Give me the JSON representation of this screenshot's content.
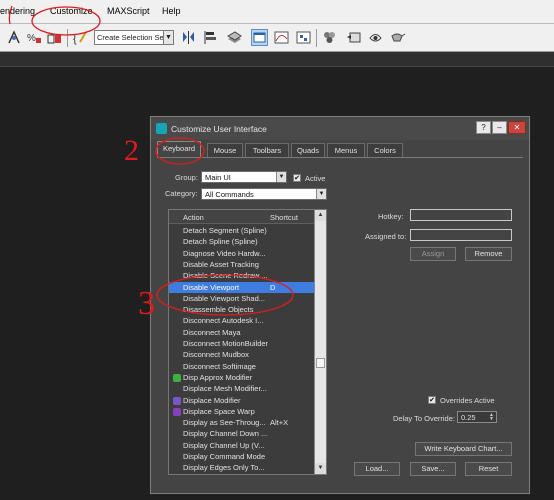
{
  "menubar": {
    "items": [
      {
        "label": "endering",
        "name": "menu-rendering"
      },
      {
        "label": "Customize",
        "name": "menu-customize"
      },
      {
        "label": "MAXScript",
        "name": "menu-maxscript"
      },
      {
        "label": "Help",
        "name": "menu-help"
      }
    ]
  },
  "toolbar": {
    "selection_set": "Create Selection Se",
    "icons": [
      "link-icon",
      "unlink-icon",
      "bind-space-warp-icon",
      "select-icon",
      "select-by-name-icon",
      "percent-snap-icon",
      "spinner-snap-icon",
      "edit-named-selection-icon",
      "mirror-icon",
      "align-icon",
      "layer-manager-icon",
      "scene-explorer-icon",
      "curve-editor-icon",
      "schematic-view-icon",
      "material-editor-icon",
      "render-setup-icon",
      "rendered-frame-icon",
      "render-icon"
    ]
  },
  "dialog": {
    "title": "Customize User Interface",
    "tabs": [
      "Keyboard",
      "Mouse",
      "Toolbars",
      "Quads",
      "Menus",
      "Colors"
    ],
    "group_label": "Group:",
    "group_value": "Main UI",
    "active_label": "Active",
    "category_label": "Category:",
    "category_value": "All Commands",
    "list_header": {
      "action": "Action",
      "shortcut": "Shortcut"
    },
    "rows": [
      {
        "action": "Detach Segment (Spline)",
        "shortcut": ""
      },
      {
        "action": "Detach Spline (Spline)",
        "shortcut": ""
      },
      {
        "action": "Diagnose Video Hardw...",
        "shortcut": ""
      },
      {
        "action": "Disable Asset Tracking",
        "shortcut": ""
      },
      {
        "action": "Disable Scene Redraw ...",
        "shortcut": ""
      },
      {
        "action": "Disable Viewport",
        "shortcut": "D"
      },
      {
        "action": "Disable Viewport Shad...",
        "shortcut": ""
      },
      {
        "action": "Disassemble Objects",
        "shortcut": ""
      },
      {
        "action": "Disconnect Autodesk I...",
        "shortcut": ""
      },
      {
        "action": "Disconnect Maya",
        "shortcut": ""
      },
      {
        "action": "Disconnect MotionBuilder",
        "shortcut": ""
      },
      {
        "action": "Disconnect Mudbox",
        "shortcut": ""
      },
      {
        "action": "Disconnect Softimage",
        "shortcut": ""
      },
      {
        "action": "Disp Approx Modifier",
        "shortcut": ""
      },
      {
        "action": "Displace Mesh Modifier...",
        "shortcut": ""
      },
      {
        "action": "Displace Modifier",
        "shortcut": ""
      },
      {
        "action": "Displace Space Warp",
        "shortcut": ""
      },
      {
        "action": "Display as See-Throug...",
        "shortcut": "Alt+X"
      },
      {
        "action": "Display Channel Down ...",
        "shortcut": ""
      },
      {
        "action": "Display Channel Up (V...",
        "shortcut": ""
      },
      {
        "action": "Display Command Mode",
        "shortcut": ""
      },
      {
        "action": "Display Edges Only To...",
        "shortcut": ""
      }
    ],
    "selected_index": 5,
    "hotkey_label": "Hotkey:",
    "assigned_label": "Assigned to:",
    "assign_button": "Assign",
    "remove_button": "Remove",
    "overrides_label": "Overrides Active",
    "delay_label": "Delay To Override:",
    "delay_value": "0.25",
    "write_button": "Write Keyboard Chart...",
    "load_button": "Load...",
    "save_button": "Save...",
    "reset_button": "Reset"
  },
  "annotations": {
    "mark_tab": "2",
    "mark_row": "3"
  },
  "colors": {
    "selection": "#3f7ce0",
    "annotation": "#e01b1b",
    "dialog_bg": "#444444"
  }
}
